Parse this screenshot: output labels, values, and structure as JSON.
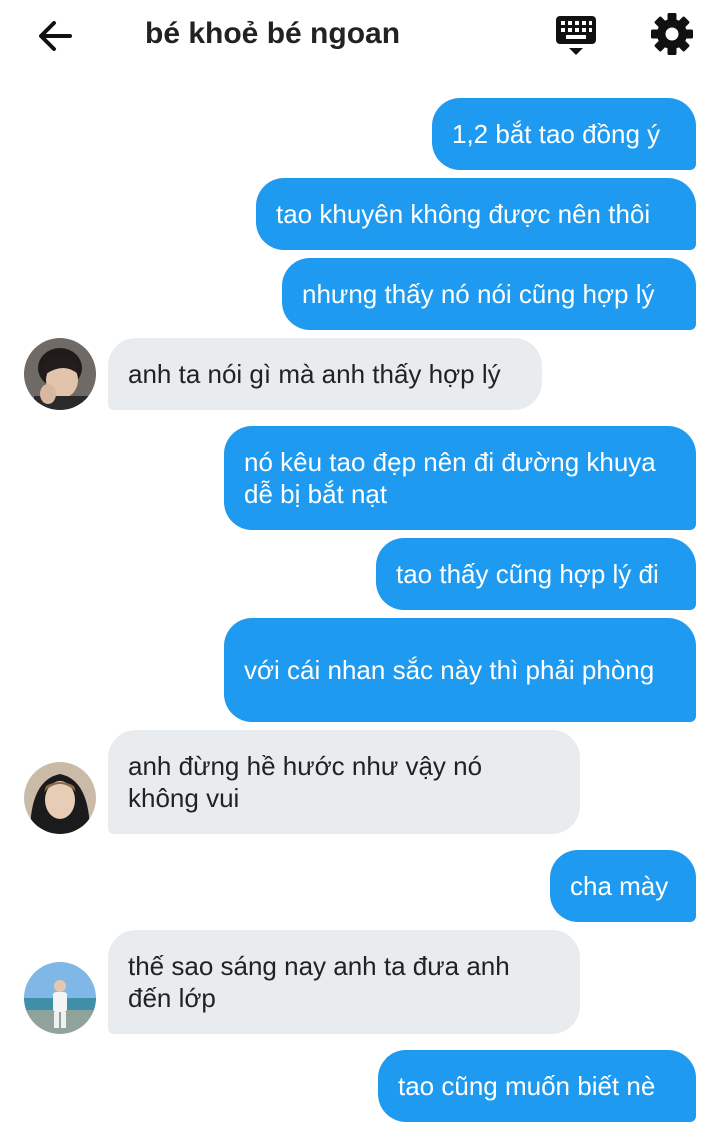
{
  "header": {
    "title": "bé khoẻ bé ngoan",
    "back_icon": "arrow-left-icon",
    "keyboard_icon": "keyboard-icon",
    "settings_icon": "gear-icon"
  },
  "messages": [
    {
      "side": "out",
      "text": "1,2 bắt tao đồng ý"
    },
    {
      "side": "out",
      "text": "tao khuyên không được nên thôi"
    },
    {
      "side": "out",
      "text": "nhưng thấy nó nói cũng hợp lý"
    },
    {
      "side": "in",
      "text": "anh ta nói gì mà anh thấy hợp lý"
    },
    {
      "side": "out",
      "text": "nó kêu tao đẹp nên đi đường khuya dễ bị bắt nạt"
    },
    {
      "side": "out",
      "text": "tao thấy cũng hợp lý đi"
    },
    {
      "side": "out",
      "text": "với cái nhan sắc này thì phải phòng"
    },
    {
      "side": "in",
      "text": "anh đừng hề hước như vậy nó không vui"
    },
    {
      "side": "out",
      "text": "cha mày"
    },
    {
      "side": "in",
      "text": "thế sao sáng nay anh ta đưa anh đến lớp"
    },
    {
      "side": "out",
      "text": "tao cũng muốn biết nè"
    }
  ],
  "colors": {
    "outgoing_bubble": "#1e9bf0",
    "incoming_bubble": "#e9ecef"
  }
}
